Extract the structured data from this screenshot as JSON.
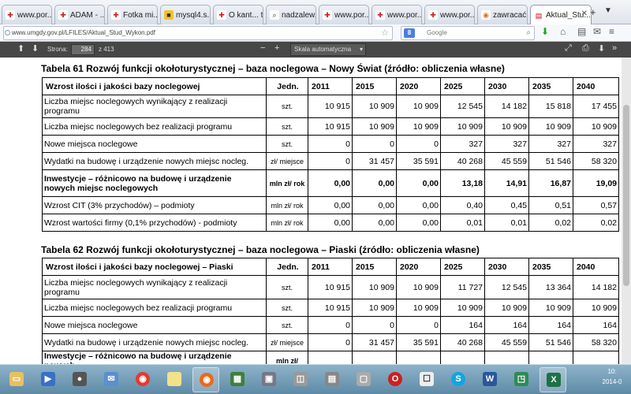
{
  "tabs": [
    {
      "label": "www.por...",
      "icon": "red-shield-icon"
    },
    {
      "label": "ADAM - ...",
      "icon": "red-shield-icon"
    },
    {
      "label": "Fotka mi...",
      "icon": "red-shield-icon"
    },
    {
      "label": "mysql4.s...",
      "icon": "page-icon"
    },
    {
      "label": "O kant... t...",
      "icon": "red-shield-icon"
    },
    {
      "label": "nadzalew...",
      "icon": "search-icon"
    },
    {
      "label": "www.por...",
      "icon": "red-shield-icon"
    },
    {
      "label": "www.por...",
      "icon": "red-shield-icon"
    },
    {
      "label": "www.por...",
      "icon": "red-shield-icon"
    },
    {
      "label": "zawracać ...",
      "icon": "chrome-icon"
    },
    {
      "label": "Aktual_Stu...",
      "icon": "pdf-icon"
    }
  ],
  "address": {
    "url": "www.umgdy.gov.pl/LFILES/Aktual_Stud_Wykon.pdf"
  },
  "search": {
    "placeholder": "Google"
  },
  "pdf_toolbar": {
    "page_label": "Strona:",
    "page_value": "284",
    "page_total": "z 413",
    "zoom": "Skala automatyczna"
  },
  "table61": {
    "caption": "Tabela 61 Rozwój funkcji okołoturystycznej – baza noclegowa – Nowy Świat (źródło: obliczenia własne)",
    "header": {
      "label": "Wzrost ilości i jakości bazy noclegowej",
      "unit": "Jedn.",
      "years": [
        "2011",
        "2015",
        "2020",
        "2025",
        "2030",
        "2035",
        "2040"
      ]
    },
    "rows": [
      {
        "label": "Liczba miejsc noclegowych wynikający z realizacji programu",
        "unit": "szt.",
        "values": [
          "10 915",
          "10 909",
          "10 909",
          "12 545",
          "14 182",
          "15 818",
          "17 455"
        ],
        "bold": false
      },
      {
        "label": "Liczba miejsc noclegowych bez realizacji programu",
        "unit": "szt.",
        "values": [
          "10 915",
          "10 909",
          "10 909",
          "10 909",
          "10 909",
          "10 909",
          "10 909"
        ],
        "bold": false
      },
      {
        "label": "Nowe miejsca noclegowe",
        "unit": "szt.",
        "values": [
          "0",
          "0",
          "0",
          "327",
          "327",
          "327",
          "327"
        ],
        "bold": false
      },
      {
        "label": "Wydatki na budowę i urządzenie nowych miejsc nocleg.",
        "unit": "zł/ miejsce",
        "values": [
          "0",
          "31 457",
          "35 591",
          "40 268",
          "45 559",
          "51 546",
          "58 320"
        ],
        "bold": false
      },
      {
        "label": "Inwestycje – różnicowo na budowę i urządzenie nowych miejsc noclegowych",
        "unit": "mln zł/ rok",
        "values": [
          "0,00",
          "0,00",
          "0,00",
          "13,18",
          "14,91",
          "16,87",
          "19,09"
        ],
        "bold": true
      },
      {
        "label": "Wzrost CIT (3% przychodów) – podmioty",
        "unit": "mln zł/ rok",
        "values": [
          "0,00",
          "0,00",
          "0,00",
          "0,40",
          "0,45",
          "0,51",
          "0,57"
        ],
        "bold": false
      },
      {
        "label": "Wzrost wartości firmy (0,1% przychodów) - podmioty",
        "unit": "mln zł/ rok",
        "values": [
          "0,00",
          "0,00",
          "0,00",
          "0,01",
          "0,01",
          "0,02",
          "0,02"
        ],
        "bold": false
      }
    ]
  },
  "table62": {
    "caption": "Tabela 62 Rozwój funkcji okołoturystycznej – baza noclegowa – Piaski (źródło: obliczenia własne)",
    "header": {
      "label": "Wzrost ilości i jakości bazy noclegowej – Piaski",
      "unit": "Jedn.",
      "years": [
        "2011",
        "2015",
        "2020",
        "2025",
        "2030",
        "2035",
        "2040"
      ]
    },
    "rows": [
      {
        "label": "Liczba miejsc noclegowych wynikający z realizacji programu",
        "unit": "szt.",
        "values": [
          "10 915",
          "10 909",
          "10 909",
          "11 727",
          "12 545",
          "13 364",
          "14 182"
        ],
        "bold": false
      },
      {
        "label": "Liczba miejsc noclegowych bez realizacji programu",
        "unit": "szt.",
        "values": [
          "10 915",
          "10 909",
          "10 909",
          "10 909",
          "10 909",
          "10 909",
          "10 909"
        ],
        "bold": false
      },
      {
        "label": "Nowe miejsca noclegowe",
        "unit": "szt.",
        "values": [
          "0",
          "0",
          "0",
          "164",
          "164",
          "164",
          "164"
        ],
        "bold": false
      },
      {
        "label": "Wydatki na budowę i urządzenie nowych miejsc nocleg.",
        "unit": "zł/ miejsce",
        "values": [
          "0",
          "31 457",
          "35 591",
          "40 268",
          "45 559",
          "51 546",
          "58 320"
        ],
        "bold": false
      },
      {
        "label": "Inwestycje – różnicowo na budowę i urządzenie nowych",
        "unit": "mln zł/",
        "values": [
          "",
          "",
          "",
          "",
          "",
          "",
          ""
        ],
        "bold": true
      }
    ]
  },
  "taskbar": {
    "clock": "10:",
    "date": "2014-0"
  },
  "colors": {
    "pdf_toolbar": "#474747",
    "taskbar": "#5f8aa6"
  }
}
